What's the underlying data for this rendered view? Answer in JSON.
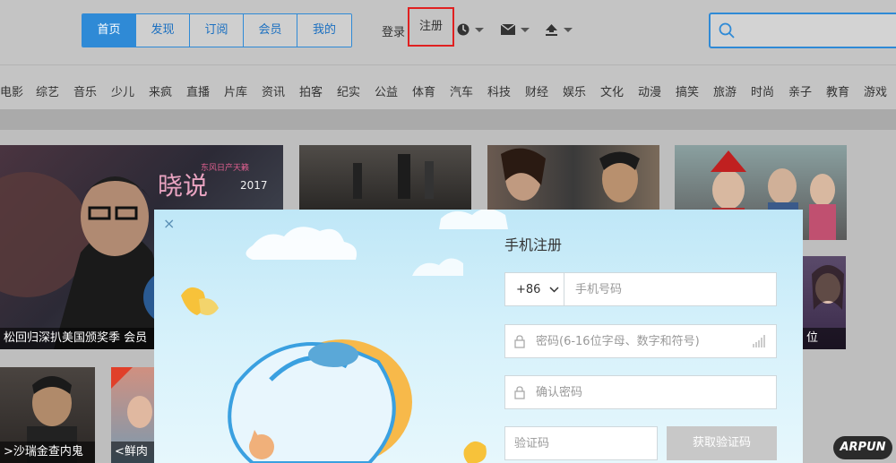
{
  "header": {
    "nav": [
      "首页",
      "发现",
      "订阅",
      "会员",
      "我的"
    ],
    "login": "登录",
    "register": "注册",
    "icons": [
      "clock-icon",
      "mail-icon",
      "upload-icon"
    ],
    "search_placeholder": ""
  },
  "categories": [
    "电影",
    "综艺",
    "音乐",
    "少儿",
    "来疯",
    "直播",
    "片库",
    "资讯",
    "拍客",
    "纪实",
    "公益",
    "体育",
    "汽车",
    "科技",
    "财经",
    "娱乐",
    "文化",
    "动漫",
    "搞笑",
    "旅游",
    "时尚",
    "亲子",
    "教育",
    "游戏"
  ],
  "content": {
    "banner_caption": "松回归深扒美国颁奖季 会员",
    "banner_logo_text": "晓说",
    "banner_logo_sub": "东风日产天籁",
    "banner_year": "2017",
    "thumb_caption_1": ">沙瑞金查内鬼",
    "thumb_caption_2": "<鲜肉",
    "side_caption": "位"
  },
  "modal": {
    "title": "手机注册",
    "country_code": "+86",
    "phone_placeholder": "手机号码",
    "password_placeholder": "密码(6-16位字母、数字和符号)",
    "confirm_placeholder": "确认密码",
    "code_placeholder": "验证码",
    "get_code_button": "获取验证码"
  },
  "watermark": "ARPUN",
  "colors": {
    "accent": "#2f8ad6",
    "highlight_box": "#e02020"
  }
}
